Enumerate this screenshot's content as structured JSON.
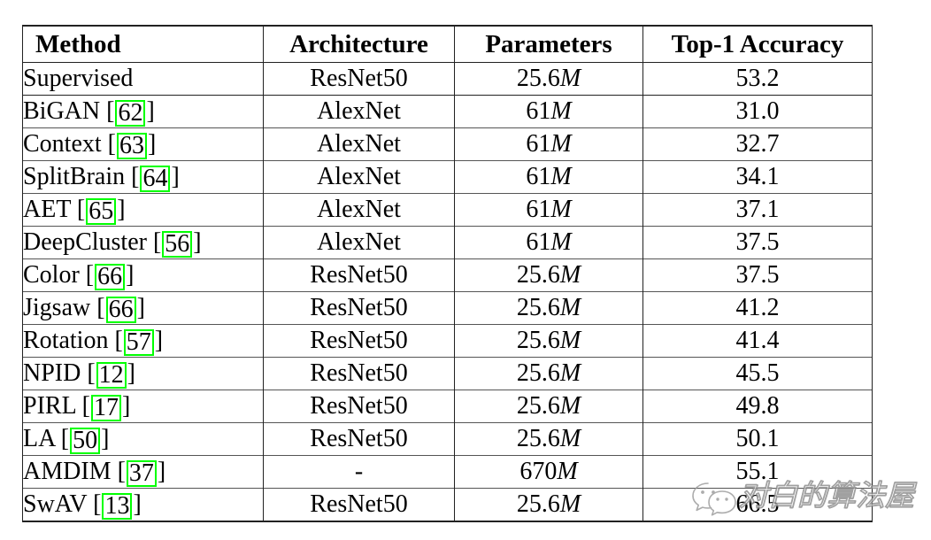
{
  "table": {
    "columns": [
      {
        "key": "method",
        "label": "Method",
        "align": "left"
      },
      {
        "key": "architecture",
        "label": "Architecture",
        "align": "center"
      },
      {
        "key": "parameters",
        "label": "Parameters",
        "align": "center"
      },
      {
        "key": "accuracy",
        "label": "Top-1 Accuracy",
        "align": "center"
      }
    ],
    "rows": [
      {
        "method": "Supervised",
        "citation": "",
        "architecture": "ResNet50",
        "parameters_value": "25.6",
        "parameters_unit": "M",
        "accuracy": "53.2"
      },
      {
        "method": "BiGAN",
        "citation": "62",
        "architecture": "AlexNet",
        "parameters_value": "61",
        "parameters_unit": "M",
        "accuracy": "31.0"
      },
      {
        "method": "Context",
        "citation": "63",
        "architecture": "AlexNet",
        "parameters_value": "61",
        "parameters_unit": "M",
        "accuracy": "32.7"
      },
      {
        "method": "SplitBrain",
        "citation": "64",
        "architecture": "AlexNet",
        "parameters_value": "61",
        "parameters_unit": "M",
        "accuracy": "34.1"
      },
      {
        "method": "AET",
        "citation": "65",
        "architecture": "AlexNet",
        "parameters_value": "61",
        "parameters_unit": "M",
        "accuracy": "37.1"
      },
      {
        "method": "DeepCluster",
        "citation": "56",
        "architecture": "AlexNet",
        "parameters_value": "61",
        "parameters_unit": "M",
        "accuracy": "37.5"
      },
      {
        "method": "Color",
        "citation": "66",
        "architecture": "ResNet50",
        "parameters_value": "25.6",
        "parameters_unit": "M",
        "accuracy": "37.5"
      },
      {
        "method": "Jigsaw",
        "citation": "66",
        "architecture": "ResNet50",
        "parameters_value": "25.6",
        "parameters_unit": "M",
        "accuracy": "41.2"
      },
      {
        "method": "Rotation",
        "citation": "57",
        "architecture": "ResNet50",
        "parameters_value": "25.6",
        "parameters_unit": "M",
        "accuracy": "41.4"
      },
      {
        "method": "NPID",
        "citation": "12",
        "architecture": "ResNet50",
        "parameters_value": "25.6",
        "parameters_unit": "M",
        "accuracy": "45.5"
      },
      {
        "method": "PIRL",
        "citation": "17",
        "architecture": "ResNet50",
        "parameters_value": "25.6",
        "parameters_unit": "M",
        "accuracy": "49.8"
      },
      {
        "method": "LA",
        "citation": "50",
        "architecture": "ResNet50",
        "parameters_value": "25.6",
        "parameters_unit": "M",
        "accuracy": "50.1"
      },
      {
        "method": "AMDIM",
        "citation": "37",
        "architecture": "-",
        "parameters_value": "670",
        "parameters_unit": "M",
        "accuracy": "55.1"
      },
      {
        "method": "SwAV",
        "citation": "13",
        "architecture": "ResNet50",
        "parameters_value": "25.6",
        "parameters_unit": "M",
        "accuracy": "66.5"
      }
    ]
  },
  "highlight": {
    "color": "#00ff00",
    "bracket_open": "[",
    "bracket_close": "]"
  },
  "watermark": {
    "text": "对白的算法屋",
    "logo": "wechat-icon"
  }
}
